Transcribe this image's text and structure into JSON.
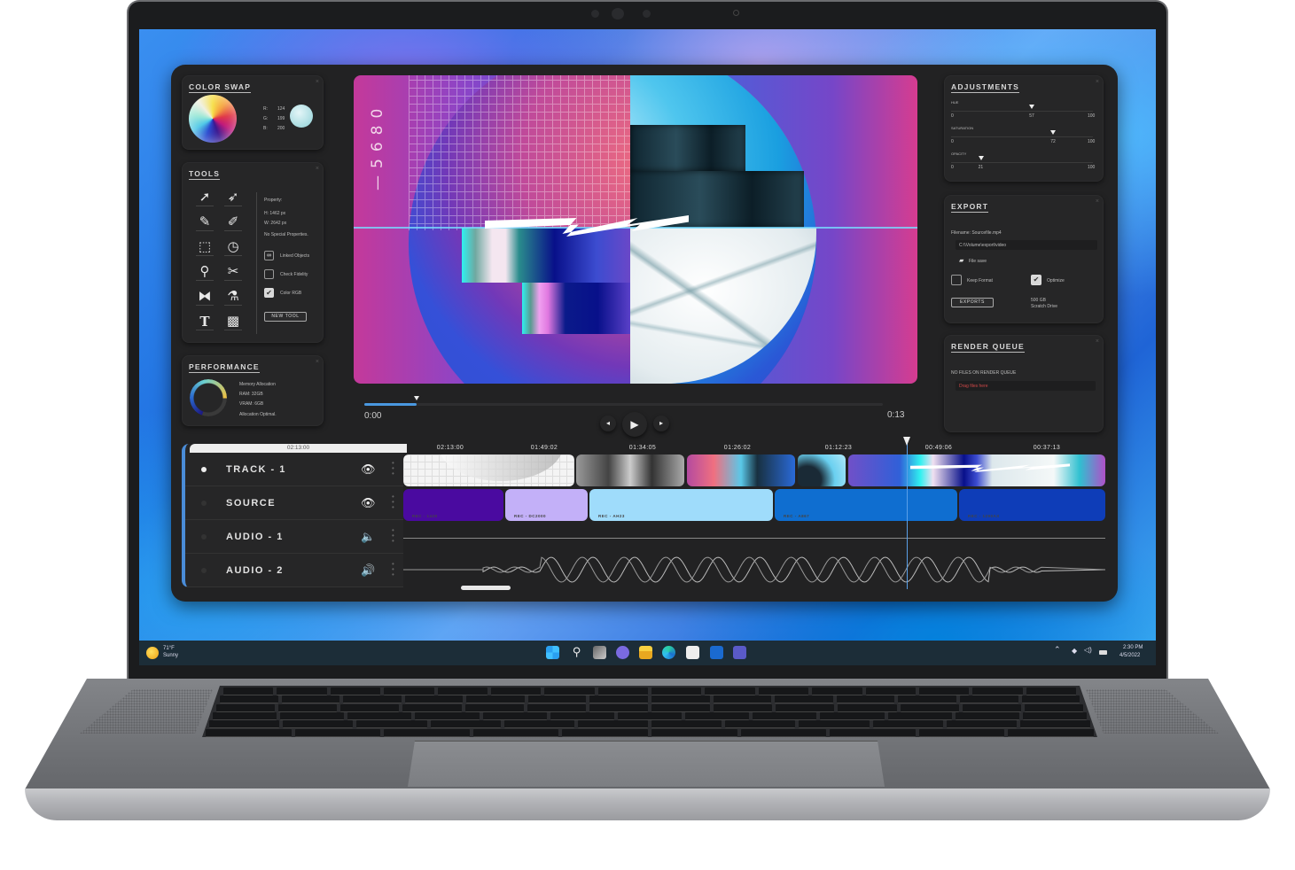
{
  "app": {
    "color_swap": {
      "title": "COLOR SWAP",
      "r_label": "R:",
      "r_value": "124",
      "g_label": "G:",
      "g_value": "199",
      "b_label": "B:",
      "b_value": "200",
      "swatch_color": "#7cc7c8"
    },
    "tools": {
      "title": "TOOLS",
      "icons": [
        "arrow-select-icon",
        "direct-select-icon",
        "pencil-icon",
        "brush-icon",
        "crop-icon",
        "rotate-icon",
        "zoom-icon",
        "scissors-icon",
        "flip-icon",
        "eyedropper-icon",
        "text-icon",
        "gradient-icon"
      ],
      "glyphs": [
        "➚",
        "➶",
        "✎",
        "✐",
        "⬚",
        "◷",
        "⚲",
        "✂",
        "⧓",
        "⚗",
        "T",
        "▩"
      ],
      "property_label": "Property:",
      "height": "H: 1462 px",
      "width": "W: 2642 px",
      "special": "No Special Properties.",
      "checkboxes": [
        {
          "label": "Linked Objects",
          "checked": false,
          "icon": "🔗"
        },
        {
          "label": "Check Fidelity",
          "checked": false
        },
        {
          "label": "Color RGB",
          "checked": true
        }
      ],
      "new_tool_label": "NEW TOOL"
    },
    "performance": {
      "title": "PERFORMANCE",
      "heading": "Memory Allocation",
      "ram": "RAM: 32GB",
      "vram": "VRAM: 6GB",
      "status": "Allocation Optimal.",
      "ring_fill_percent": 70
    },
    "adjustments": {
      "title": "ADJUSTMENTS",
      "sliders": [
        {
          "label": "HUE",
          "min": "0",
          "max": "100",
          "value": 57
        },
        {
          "label": "SATURATION",
          "min": "0",
          "max": "100",
          "value": 72
        },
        {
          "label": "OPACITY",
          "min": "0",
          "max": "100",
          "value": 21
        }
      ]
    },
    "export": {
      "title": "EXPORT",
      "filename": "Filename: Sourcefile.mp4",
      "path": "C:\\\\Volume\\export\\video",
      "file_save": "File save",
      "keep_format": {
        "label": "Keep Format",
        "checked": false
      },
      "optimize": {
        "label": "Optimize",
        "checked": true
      },
      "exports_button": "EXPORTS",
      "storage_size": "500 GB",
      "storage_label": "Scratch Drive"
    },
    "render_queue": {
      "title": "RENDER QUEUE",
      "status": "NO FILES ON RENDER QUEUE",
      "drop_placeholder": "Drag files here"
    },
    "preview": {
      "overlay_number": "5680"
    },
    "player": {
      "time_start": "0:00",
      "time_end": "0:13",
      "progress_fraction": 0.1,
      "prev_glyph": "◂",
      "play_glyph": "▶",
      "next_glyph": "▸"
    },
    "timeline": {
      "header_time": "02:13:00",
      "ruler": [
        "02:13:00",
        "01:49:02",
        "01:34:05",
        "01:26:02",
        "01:12:23",
        "00:49:06",
        "00:37:13"
      ],
      "playhead_fraction": 0.715,
      "tracks": [
        {
          "name": "TRACK - 1",
          "active": true,
          "icon": "eye-icon",
          "glyph": "👁"
        },
        {
          "name": "SOURCE",
          "active": false,
          "icon": "eye-icon",
          "glyph": "👁"
        },
        {
          "name": "AUDIO - 1",
          "active": false,
          "icon": "speaker-icon",
          "glyph": "🔈"
        },
        {
          "name": "AUDIO - 2",
          "active": false,
          "icon": "speaker-loud-icon",
          "glyph": "🔊"
        }
      ],
      "source_clips": [
        {
          "label": "REC - 1420",
          "color": "#4a0aa0"
        },
        {
          "label": "REC - DC2000",
          "color": "#c3b0f8"
        },
        {
          "label": "REC - AH23",
          "color": "#9fdcfb"
        },
        {
          "label": "REC - A867",
          "color": "#0f6ed0"
        },
        {
          "label": "REC - 1290AX",
          "color": "#0e3db8"
        }
      ]
    }
  },
  "taskbar": {
    "weather_temp": "71°F",
    "weather_desc": "Sunny",
    "apps": [
      "start-icon",
      "search-icon",
      "task-view-icon",
      "chat-icon",
      "file-explorer-icon",
      "edge-icon",
      "store-icon",
      "outlook-icon",
      "teams-icon"
    ],
    "time": "2:30 PM",
    "date": "4/5/2022"
  }
}
